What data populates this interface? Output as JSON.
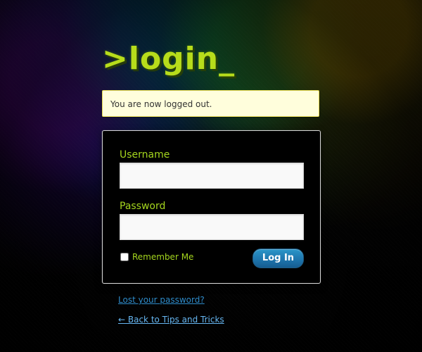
{
  "brand": {
    "logo_text": ">login_"
  },
  "notice": {
    "message": "You are now logged out."
  },
  "login_form": {
    "username_label": "Username",
    "username_value": "",
    "password_label": "Password",
    "password_value": "",
    "remember_label": "Remember Me",
    "remember_checked": false,
    "submit_label": "Log In"
  },
  "links": {
    "lost_password": "Lost your password?",
    "back_to_site": "← Back to Tips and Tricks"
  },
  "colors": {
    "logo": "#b7dc1b",
    "field_label": "#a4d51e",
    "notice_background": "#fffedc",
    "notice_border": "#e6db55",
    "button": "#1e76ae",
    "link": "#2e8bc9"
  },
  "icons": {
    "remember_checkbox": "checkbox-unchecked"
  }
}
